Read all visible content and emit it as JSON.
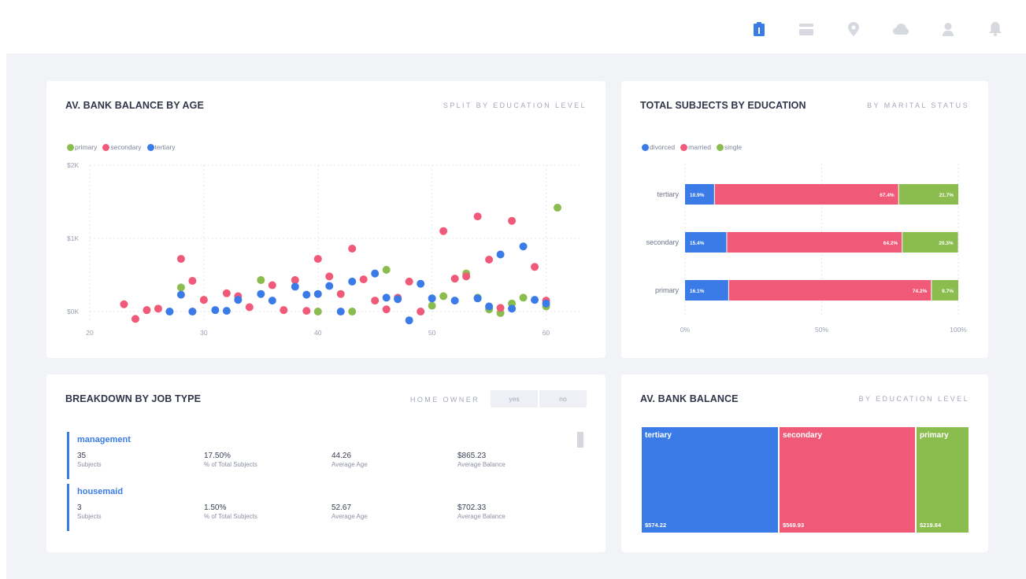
{
  "topbar": {
    "icons": [
      "clipboard-icon",
      "card-icon",
      "location-pin-icon",
      "cloud-icon",
      "user-icon",
      "bell-icon"
    ],
    "active_color": "#3a7be8",
    "inactive_color": "#d7d9e0"
  },
  "colors": {
    "primary": "#8bbd4e",
    "secondary": "#f05a78",
    "tertiary": "#3a7be8",
    "divorced": "#3a7be8",
    "married": "#f05a78",
    "single": "#8bbd4e"
  },
  "scatter": {
    "title": "AV. BANK BALANCE BY AGE",
    "subtitle": "SPLIT BY EDUCATION LEVEL",
    "legend": [
      "primary",
      "secondary",
      "tertiary"
    ]
  },
  "stacked": {
    "title": "TOTAL SUBJECTS BY EDUCATION",
    "subtitle": "BY MARITAL STATUS",
    "legend": [
      "divorced",
      "married",
      "single"
    ]
  },
  "jobs": {
    "title": "BREAKDOWN BY JOB TYPE",
    "home_owner_label": "HOME OWNER",
    "toggle": [
      "yes",
      "no"
    ],
    "rows": [
      {
        "name": "management",
        "subjects": "35",
        "subjects_label": "Subjects",
        "pct": "17.50%",
        "pct_label": "% of Total Subjects",
        "age": "44.26",
        "age_label": "Average Age",
        "balance": "$865.23",
        "balance_label": "Average Balance"
      },
      {
        "name": "housemaid",
        "subjects": "3",
        "subjects_label": "Subjects",
        "pct": "1.50%",
        "pct_label": "% of Total Subjects",
        "age": "52.67",
        "age_label": "Average Age",
        "balance": "$702.33",
        "balance_label": "Average Balance"
      }
    ]
  },
  "treemap": {
    "title": "AV. BANK BALANCE",
    "subtitle": "BY EDUCATION LEVEL",
    "cells": [
      {
        "name": "tertiary",
        "value": "$574.22"
      },
      {
        "name": "secondary",
        "value": "$569.93"
      },
      {
        "name": "primary",
        "value": "$219.84"
      }
    ]
  },
  "chart_data": [
    {
      "type": "scatter",
      "title": "AV. BANK BALANCE BY AGE",
      "subtitle": "SPLIT BY EDUCATION LEVEL",
      "xlabel": "",
      "ylabel": "",
      "xlim": [
        20,
        63
      ],
      "ylim": [
        -150,
        2000
      ],
      "x_ticks": [
        20,
        30,
        40,
        50,
        60
      ],
      "y_ticks": [
        0,
        1000,
        2000
      ],
      "y_tick_labels": [
        "$0K",
        "$1K",
        "$2K"
      ],
      "grid": true,
      "legend_position": "top-left",
      "series": [
        {
          "name": "primary",
          "points": [
            [
              28,
              330
            ],
            [
              35,
              430
            ],
            [
              40,
              0
            ],
            [
              43,
              0
            ],
            [
              46,
              570
            ],
            [
              50,
              80
            ],
            [
              51,
              210
            ],
            [
              53,
              520
            ],
            [
              54,
              190
            ],
            [
              55,
              30
            ],
            [
              56,
              -20
            ],
            [
              57,
              110
            ],
            [
              58,
              190
            ],
            [
              60,
              70
            ],
            [
              61,
              1420
            ]
          ]
        },
        {
          "name": "secondary",
          "points": [
            [
              23,
              100
            ],
            [
              24,
              -100
            ],
            [
              25,
              20
            ],
            [
              26,
              40
            ],
            [
              28,
              720
            ],
            [
              29,
              420
            ],
            [
              30,
              160
            ],
            [
              32,
              250
            ],
            [
              33,
              210
            ],
            [
              34,
              60
            ],
            [
              36,
              360
            ],
            [
              37,
              20
            ],
            [
              38,
              430
            ],
            [
              39,
              10
            ],
            [
              40,
              720
            ],
            [
              41,
              480
            ],
            [
              42,
              240
            ],
            [
              43,
              860
            ],
            [
              44,
              440
            ],
            [
              45,
              150
            ],
            [
              46,
              30
            ],
            [
              47,
              190
            ],
            [
              48,
              410
            ],
            [
              49,
              0
            ],
            [
              51,
              1100
            ],
            [
              52,
              450
            ],
            [
              53,
              480
            ],
            [
              54,
              1300
            ],
            [
              55,
              710
            ],
            [
              56,
              50
            ],
            [
              57,
              1240
            ],
            [
              59,
              610
            ],
            [
              60,
              150
            ]
          ]
        },
        {
          "name": "tertiary",
          "points": [
            [
              27,
              0
            ],
            [
              28,
              230
            ],
            [
              29,
              0
            ],
            [
              31,
              20
            ],
            [
              32,
              10
            ],
            [
              33,
              160
            ],
            [
              35,
              240
            ],
            [
              36,
              150
            ],
            [
              38,
              340
            ],
            [
              39,
              230
            ],
            [
              40,
              240
            ],
            [
              41,
              350
            ],
            [
              42,
              0
            ],
            [
              43,
              410
            ],
            [
              45,
              520
            ],
            [
              46,
              190
            ],
            [
              47,
              170
            ],
            [
              48,
              -120
            ],
            [
              49,
              380
            ],
            [
              50,
              180
            ],
            [
              52,
              150
            ],
            [
              54,
              180
            ],
            [
              55,
              70
            ],
            [
              56,
              780
            ],
            [
              57,
              40
            ],
            [
              58,
              890
            ],
            [
              59,
              160
            ],
            [
              60,
              110
            ]
          ]
        }
      ]
    },
    {
      "type": "bar",
      "orientation": "horizontal",
      "stacked": "percent",
      "title": "TOTAL SUBJECTS BY EDUCATION",
      "subtitle": "BY MARITAL STATUS",
      "categories": [
        "tertiary",
        "secondary",
        "primary"
      ],
      "x_ticks": [
        "0%",
        "50%",
        "100%"
      ],
      "legend_position": "top-left",
      "series": [
        {
          "name": "divorced",
          "values": [
            10.9,
            15.4,
            16.1
          ],
          "labels": [
            "10.9%",
            "15.4%",
            "16.1%"
          ]
        },
        {
          "name": "married",
          "values": [
            67.4,
            64.2,
            74.2
          ],
          "labels": [
            "67.4%",
            "64.2%",
            "74.2%"
          ]
        },
        {
          "name": "single",
          "values": [
            21.7,
            20.3,
            9.7
          ],
          "labels": [
            "21.7%",
            "20.3%",
            "9.7%"
          ]
        }
      ]
    },
    {
      "type": "treemap",
      "title": "AV. BANK BALANCE",
      "subtitle": "BY EDUCATION LEVEL",
      "categories": [
        "tertiary",
        "secondary",
        "primary"
      ],
      "values": [
        574.22,
        569.93,
        219.84
      ],
      "value_labels": [
        "$574.22",
        "$569.93",
        "$219.84"
      ]
    }
  ]
}
